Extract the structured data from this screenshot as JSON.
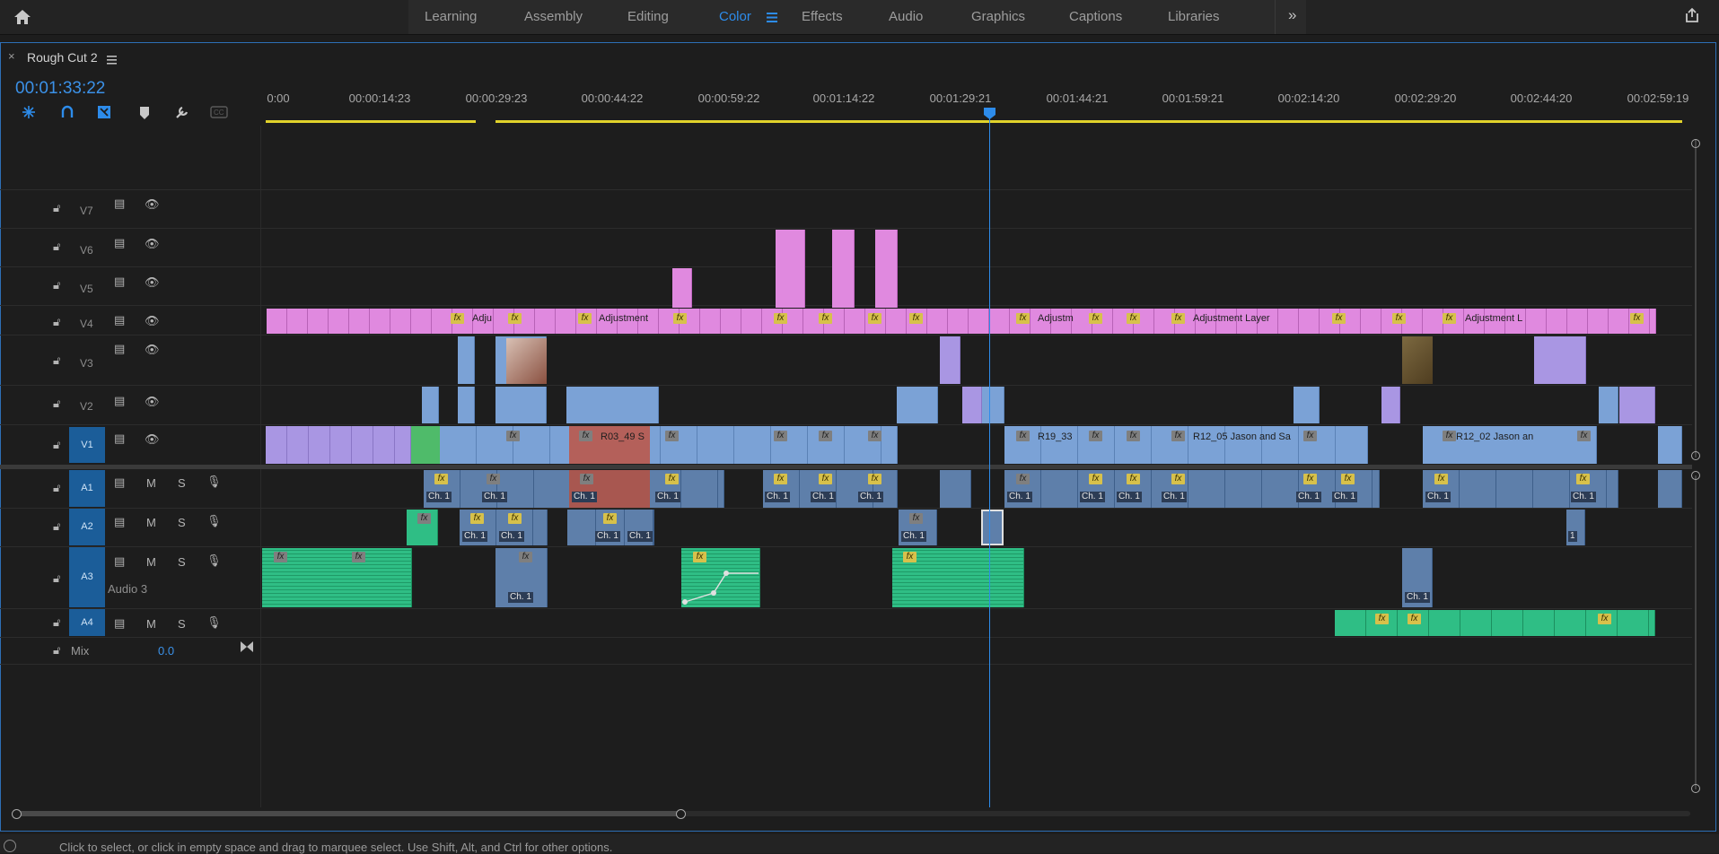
{
  "workspaces": {
    "items": [
      "Learning",
      "Assembly",
      "Editing",
      "Color",
      "Effects",
      "Audio",
      "Graphics",
      "Captions",
      "Libraries"
    ],
    "active": "Color",
    "overflow_icon": "chevron-double-right-icon",
    "home_icon": "home-icon",
    "export_icon": "share-icon"
  },
  "sequence": {
    "tab_title": "Rough Cut 2",
    "close_glyph": "×",
    "menu_icon": "hamburger-menu-icon",
    "timecode": "00:01:33:22"
  },
  "tools": [
    "snap-icon",
    "linked-selection-icon",
    "insert-overwrite-icon",
    "marker-icon",
    "wrench-icon",
    "captions-icon"
  ],
  "ruler": {
    "labels": [
      "0:00",
      "00:00:14:23",
      "00:00:29:23",
      "00:00:44:22",
      "00:00:59:22",
      "00:01:14:22",
      "00:01:29:21",
      "00:01:44:21",
      "00:01:59:21",
      "00:02:14:20",
      "00:02:29:20",
      "00:02:44:20",
      "00:02:59:19"
    ]
  },
  "video_tracks": [
    "V7",
    "V6",
    "V5",
    "V4",
    "V3",
    "V2",
    "V1"
  ],
  "audio_tracks": {
    "names": [
      "A1",
      "A2",
      "A3",
      "A4"
    ],
    "mute": "M",
    "solo": "S",
    "a3_name": "Audio 3"
  },
  "mix": {
    "label": "Mix",
    "value": "0.0"
  },
  "clip_labels": {
    "adj1": "Adju",
    "adj2": "Adjustment",
    "adj3": "Adjustm",
    "adj4": "Adjustment Layer",
    "adj5": "Adjustment L",
    "r03": "R03_49 S",
    "r19": "R19_33",
    "r12_05": "R12_05 Jason and Sa",
    "r12_02": "R12_02 Jason an",
    "ch1": "Ch. 1",
    "one": "1",
    "fx": "fx"
  },
  "colors": {
    "accent": "#2d8ceb",
    "adjustment_clip": "#e089df",
    "video_clip": "#7ba2d6",
    "nested_clip": "#a996e3",
    "audio_clip": "#5e7faa",
    "music_clip": "#2fbe85",
    "playhead": "#2d8ceb",
    "work_area": "#e1d22b"
  },
  "status_bar": "Click to select, or click in empty space and drag to marquee select. Use Shift, Alt, and Ctrl for other options."
}
